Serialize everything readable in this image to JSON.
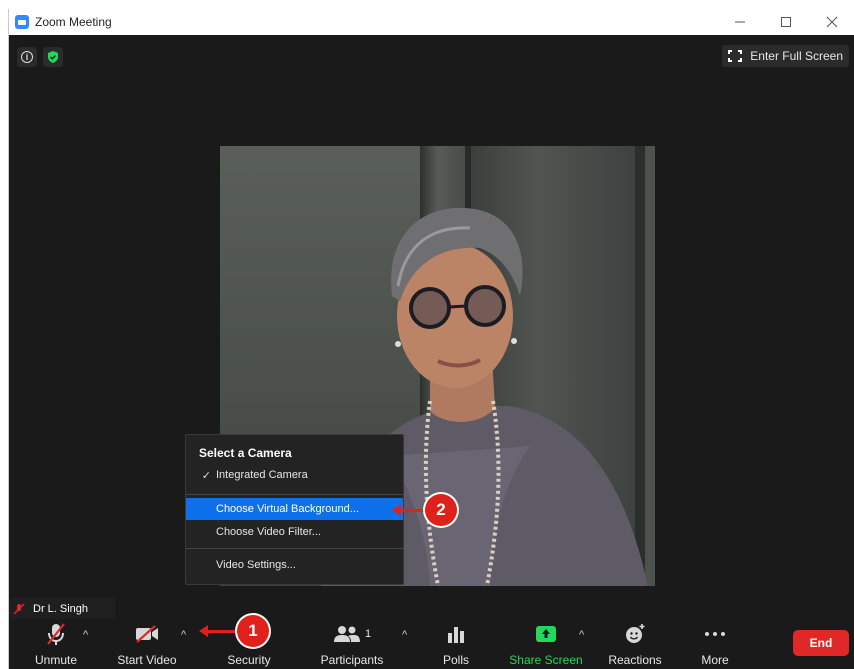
{
  "window": {
    "title": "Zoom Meeting"
  },
  "top_bar": {
    "fullscreen_label": "Enter Full Screen"
  },
  "participant": {
    "name": "Dr L. Singh"
  },
  "camera_menu": {
    "header": "Select a Camera",
    "camera_item": "Integrated Camera",
    "camera_check": "✓",
    "virtual_background": "Choose Virtual Background...",
    "video_filter": "Choose Video Filter...",
    "video_settings": "Video Settings..."
  },
  "annotations": {
    "step1": "1",
    "step2": "2"
  },
  "toolbar": {
    "unmute": "Unmute",
    "start_video": "Start Video",
    "security": "Security",
    "participants": "Participants",
    "participants_count": "1",
    "polls": "Polls",
    "share_screen": "Share Screen",
    "reactions": "Reactions",
    "more": "More",
    "end": "End",
    "caret": "^"
  },
  "colors": {
    "zoom_blue": "#2d8cff",
    "menu_highlight": "#0e71eb",
    "share_green": "#23d959",
    "end_red": "#e02828",
    "annotation_red": "#e0211b"
  },
  "icons": [
    "zoom-app-icon",
    "info-icon",
    "shield-icon",
    "fullscreen-icon",
    "microphone-muted-icon",
    "video-off-icon",
    "participants-icon",
    "polls-icon",
    "share-screen-icon",
    "reactions-icon",
    "more-dots-icon",
    "check-icon"
  ]
}
